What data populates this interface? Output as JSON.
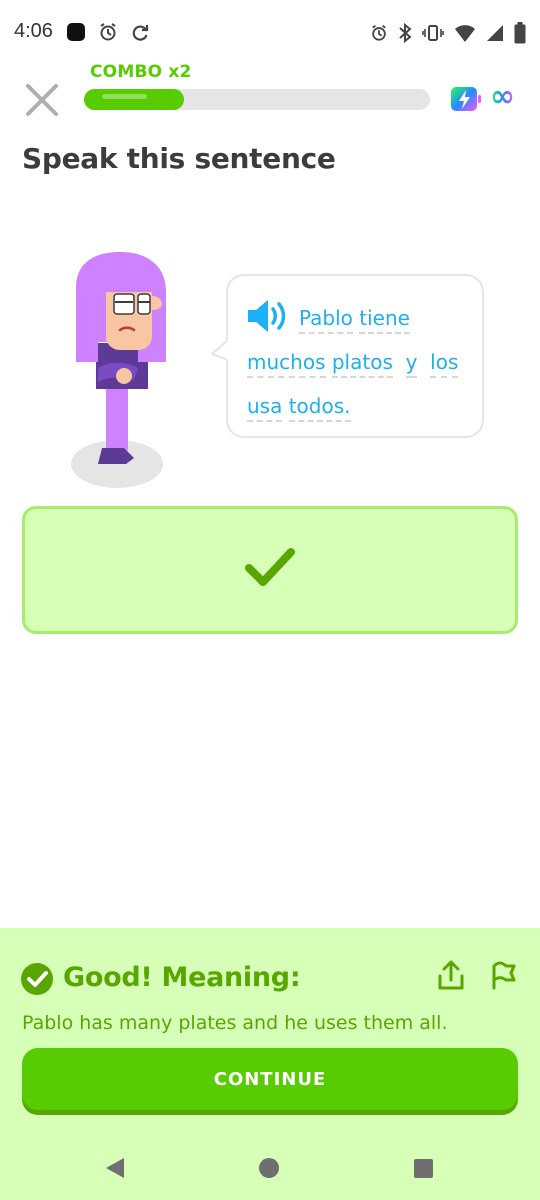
{
  "status_bar": {
    "time": "4:06",
    "left_icons": [
      "app-notification-icon",
      "alarm-icon",
      "sync-icon"
    ],
    "right_icons": [
      "alarm-icon",
      "bluetooth-icon",
      "vibrate-icon",
      "wifi-icon",
      "signal-icon",
      "battery-icon"
    ]
  },
  "header": {
    "combo_label": "COMBO x2",
    "progress_fraction": 0.29,
    "infinity_label": "∞",
    "close_icon": "close-icon",
    "energy_icon": "energy-battery-icon"
  },
  "prompt": {
    "title": "Speak this sentence"
  },
  "sentence": {
    "words": [
      "Pablo",
      "tiene",
      "muchos",
      "platos",
      "y",
      "los",
      "usa",
      "todos."
    ]
  },
  "feedback": {
    "title": "Good! Meaning:",
    "translation": "Pablo has many plates and he uses them all.",
    "continue_label": "CONTINUE"
  },
  "colors": {
    "accent_green": "#58cc02",
    "dark_green": "#58a700",
    "light_green_bg": "#d7ffb8",
    "word_blue": "#1cb0f6"
  }
}
